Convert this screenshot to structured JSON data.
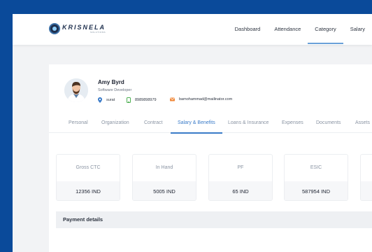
{
  "brand": {
    "name": "KRISNELA",
    "tagline": "SOLUTIONS"
  },
  "nav": [
    {
      "label": "Dashboard"
    },
    {
      "label": "Attendance"
    },
    {
      "label": "Category"
    },
    {
      "label": "Salary"
    }
  ],
  "profile": {
    "name": "Amy Byrd",
    "role": "Software Developer",
    "location": "surat",
    "phone": "8989898979",
    "email": "bamohammad@mailinator.com"
  },
  "tabs": [
    {
      "label": "Personal"
    },
    {
      "label": "Organization"
    },
    {
      "label": "Contract"
    },
    {
      "label": "Salary & Benefits"
    },
    {
      "label": "Loans & Insurance"
    },
    {
      "label": "Expenses"
    },
    {
      "label": "Documents"
    },
    {
      "label": "Assets"
    }
  ],
  "stats": [
    {
      "label": "Gross CTC",
      "value": "12356 IND"
    },
    {
      "label": "In Hand",
      "value": "5005 IND"
    },
    {
      "label": "PF",
      "value": "65 IND"
    },
    {
      "label": "ESIC",
      "value": "587954 IND"
    }
  ],
  "section": {
    "title": "Payment details"
  },
  "colors": {
    "accent": "#3a7bc8",
    "background": "#0a4a9a",
    "brand_dark": "#1e2f4d"
  },
  "icons": {
    "location": "location-pin-icon",
    "phone": "phone-icon",
    "email": "mail-icon"
  }
}
